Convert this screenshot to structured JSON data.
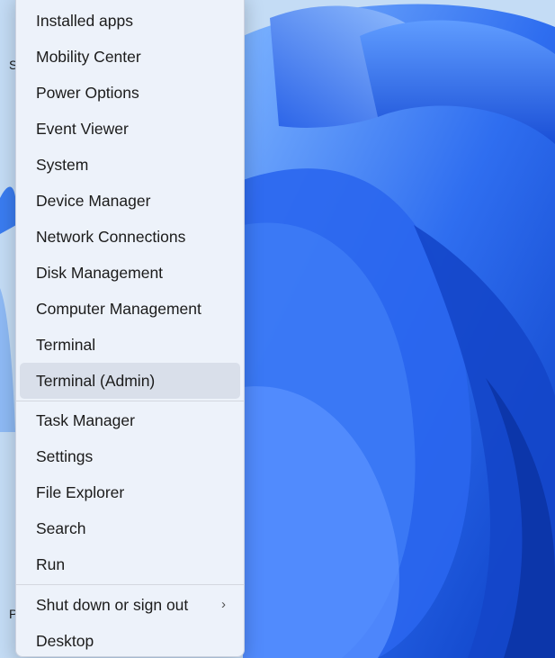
{
  "desktop": {
    "edge_glyph_1": "S",
    "edge_glyph_2": "P"
  },
  "menu": {
    "group_1": [
      {
        "label": "Installed apps"
      },
      {
        "label": "Mobility Center"
      },
      {
        "label": "Power Options"
      },
      {
        "label": "Event Viewer"
      },
      {
        "label": "System"
      },
      {
        "label": "Device Manager"
      },
      {
        "label": "Network Connections"
      },
      {
        "label": "Disk Management"
      },
      {
        "label": "Computer Management"
      },
      {
        "label": "Terminal"
      },
      {
        "label": "Terminal (Admin)"
      }
    ],
    "group_2": [
      {
        "label": "Task Manager"
      },
      {
        "label": "Settings"
      },
      {
        "label": "File Explorer"
      },
      {
        "label": "Search"
      },
      {
        "label": "Run"
      }
    ],
    "group_3": [
      {
        "label": "Shut down or sign out",
        "chevron": "›"
      },
      {
        "label": "Desktop"
      }
    ],
    "highlighted_item": "Terminal (Admin)"
  },
  "colors": {
    "wallpaper_primary": "#1f5fe0",
    "wallpaper_light": "#6fa8ff",
    "menu_background": "#eef2fa",
    "highlight": "#d2d8e4"
  }
}
